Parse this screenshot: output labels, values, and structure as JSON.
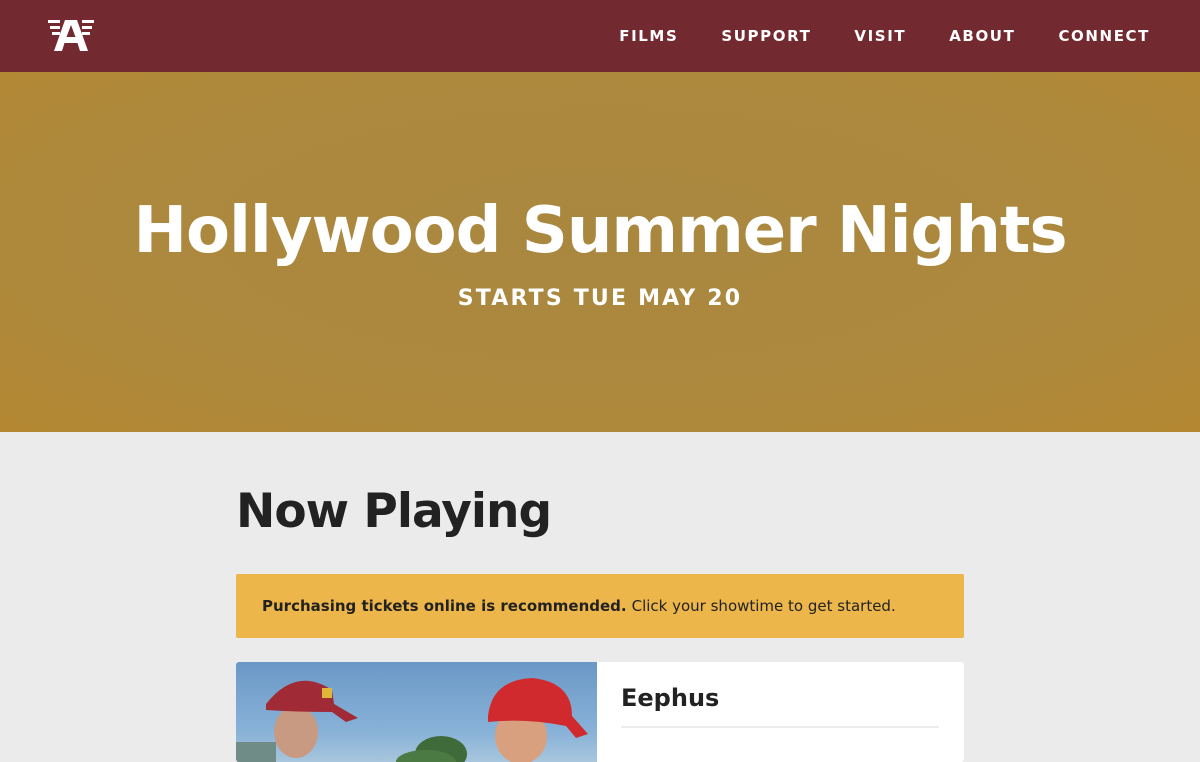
{
  "header": {
    "logo_icon": "theater-a-logo-icon",
    "nav": [
      {
        "label": "FILMS"
      },
      {
        "label": "SUPPORT"
      },
      {
        "label": "VISIT"
      },
      {
        "label": "ABOUT"
      },
      {
        "label": "CONNECT"
      }
    ]
  },
  "hero": {
    "title": "Hollywood Summer Nights",
    "subtitle": "STARTS TUE MAY 20"
  },
  "main": {
    "heading": "Now Playing",
    "notice": {
      "bold": "Purchasing tickets online is recommended.",
      "text": "Click your showtime to get started."
    },
    "films": [
      {
        "title": "Eephus"
      }
    ]
  },
  "colors": {
    "header_bg": "#722a30",
    "hero_bg": "#ad893e",
    "notice_bg": "#ecb64a",
    "page_bg": "#ebebeb"
  }
}
